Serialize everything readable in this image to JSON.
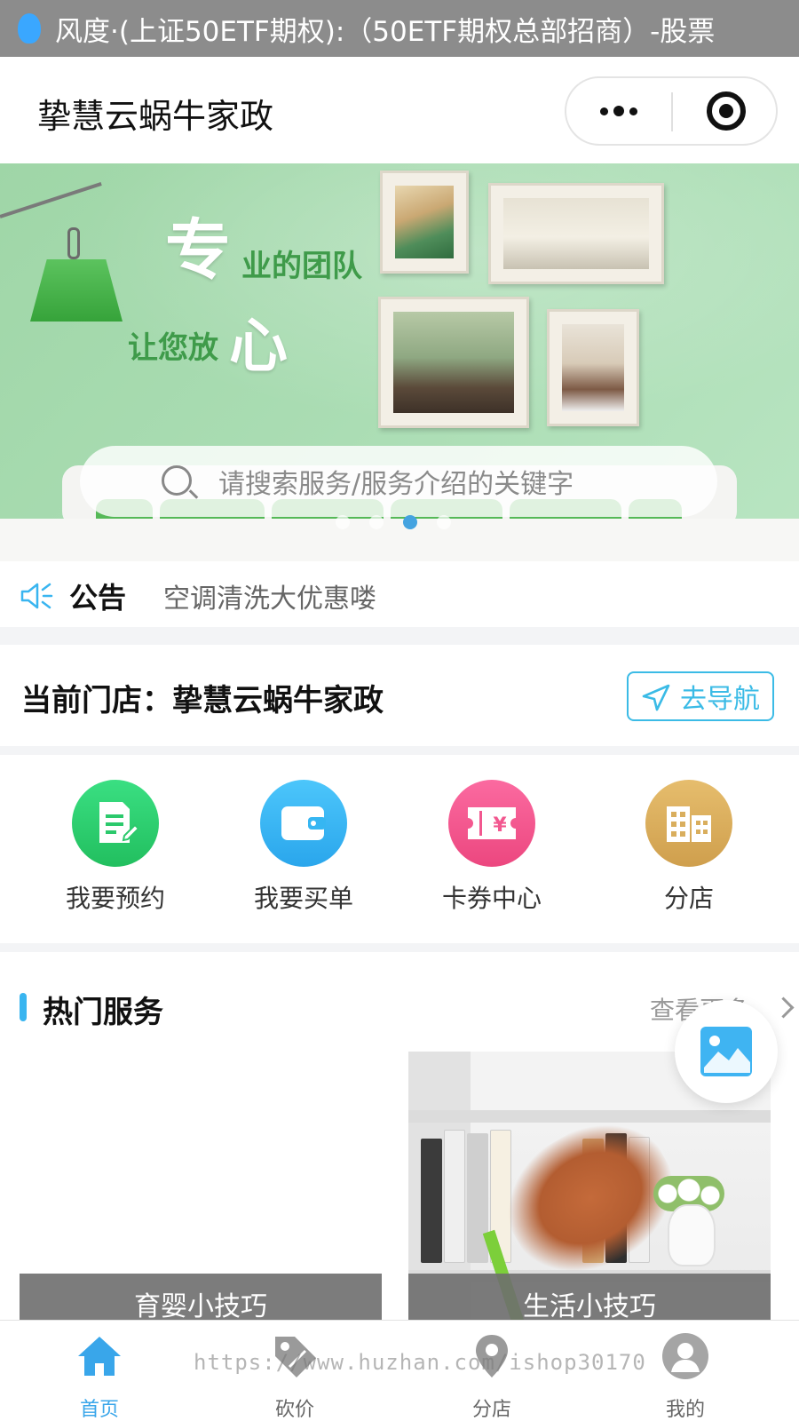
{
  "status_bar": {
    "notification": "风度·(上证50ETF期权):（50ETF期权总部招商）-股票"
  },
  "header": {
    "title": "挚慧云蜗牛家政"
  },
  "banner": {
    "slogan_big_1": "专",
    "slogan_small_1": "业的团队",
    "slogan_small_2": "让您放",
    "slogan_big_2": "心",
    "slide_count": 4,
    "active_slide": 3
  },
  "search": {
    "placeholder": "请搜索服务/服务介绍的关键字",
    "icon": "search-icon"
  },
  "notice": {
    "label": "公告",
    "text": "空调清洗大优惠喽",
    "icon": "speaker-icon"
  },
  "store": {
    "current": "当前门店：挚慧云蜗牛家政",
    "nav_label": "去导航"
  },
  "quick_menu": [
    {
      "label": "我要预约",
      "icon": "document-edit-icon",
      "color": "#2fcf72"
    },
    {
      "label": "我要买单",
      "icon": "wallet-icon",
      "color": "#36b6f2"
    },
    {
      "label": "卡券中心",
      "icon": "coupon-icon",
      "color": "#f2578f"
    },
    {
      "label": "分店",
      "icon": "building-icon",
      "color": "#d9ae5d"
    }
  ],
  "hot_services": {
    "title": "热门服务",
    "more": "查看更多",
    "cards": [
      {
        "caption": "育婴小技巧"
      },
      {
        "caption": "生活小技巧"
      }
    ]
  },
  "tabbar": [
    {
      "label": "首页",
      "icon": "home-icon",
      "active": true
    },
    {
      "label": "砍价",
      "icon": "price-tag-icon",
      "active": false
    },
    {
      "label": "分店",
      "icon": "location-pin-icon",
      "active": false
    },
    {
      "label": "我的",
      "icon": "user-icon",
      "active": false
    }
  ],
  "watermark": "https://www.huzhan.com/ishop30170",
  "colors": {
    "accent": "#39a6ea",
    "status_bar": "#8c8c8c",
    "nav_border": "#3bbbe6"
  }
}
